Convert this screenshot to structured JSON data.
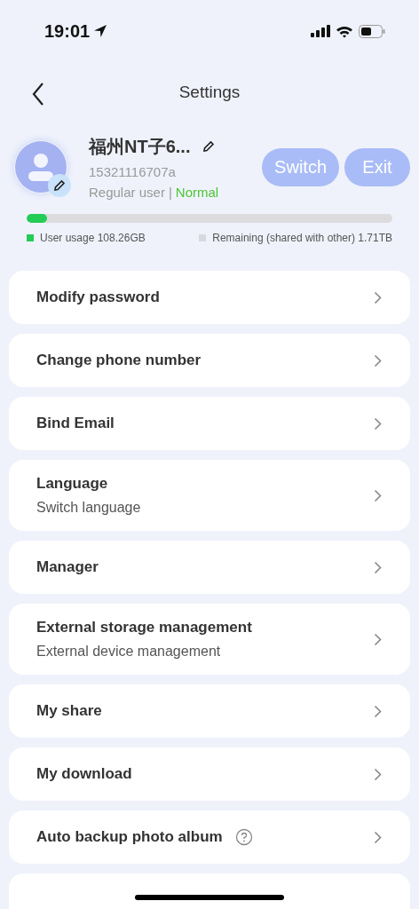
{
  "status_bar": {
    "time": "19:01"
  },
  "header": {
    "title": "Settings"
  },
  "profile": {
    "name": "福州NT子6...",
    "account": "15321116707a",
    "role": "Regular user",
    "separator": "|",
    "status": "Normal",
    "buttons": [
      "Switch",
      "Exit"
    ]
  },
  "storage": {
    "level": 0.056,
    "legend": [
      {
        "label": "User usage 108.26GB",
        "color": "#22cc55"
      },
      {
        "label": "Remaining (shared with other) 1.71TB",
        "color": "#d8d9df"
      }
    ]
  },
  "menu": [
    {
      "title": "Modify password",
      "help": false
    },
    {
      "title": "Change phone number",
      "help": false
    },
    {
      "title": "Bind Email",
      "help": false
    },
    {
      "title": "Language",
      "subtitle": "Switch language",
      "help": false
    },
    {
      "title": "Manager",
      "help": false
    },
    {
      "title": "External storage management",
      "subtitle": "External device management",
      "help": false
    },
    {
      "title": "My share",
      "help": false
    },
    {
      "title": "My download",
      "help": false
    },
    {
      "title": "Auto backup photo album",
      "help": true
    }
  ]
}
